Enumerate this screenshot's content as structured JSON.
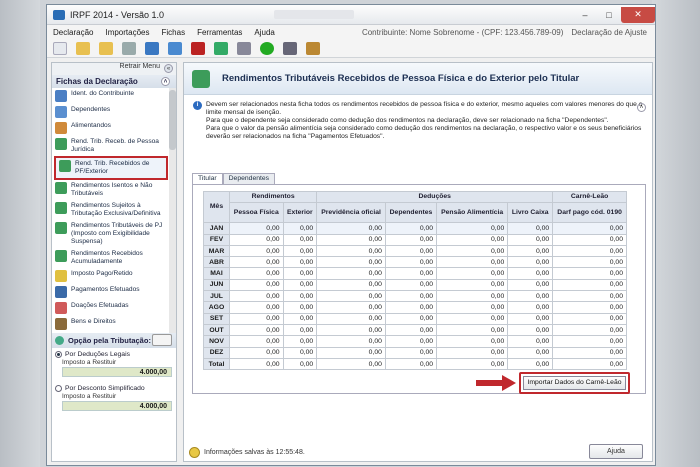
{
  "window": {
    "title": "IRPF 2014 - Versão 1.0"
  },
  "menu": {
    "items": [
      "Declaração",
      "Importações",
      "Fichas",
      "Ferramentas",
      "Ajuda"
    ],
    "contribuinte": "Contribuinte: Nome Sobrenome - (CPF: 123.456.789-09)",
    "tipo": "Declaração de Ajuste"
  },
  "sidebar": {
    "retrair": "Retrair Menu",
    "header": "Fichas da Declaração",
    "items": [
      "Ident. do Contribuinte",
      "Dependentes",
      "Alimentandos",
      "Rend. Trib. Receb. de Pessoa Jurídica",
      "Rend. Trib. Recebidos de PF/Exterior",
      "Rendimentos Isentos e Não Tributáveis",
      "Rendimentos Sujeitos à Tributação Exclusiva/Definitiva",
      "Rendimentos Tributáveis de PJ (Imposto com Exigibilidade Suspensa)",
      "Rendimentos Recebidos Acumuladamente",
      "Imposto Pago/Retido",
      "Pagamentos Efetuados",
      "Doações Efetuadas",
      "Bens e Direitos"
    ],
    "opcao": "Opção pela Tributação:",
    "deducoes": {
      "label": "Por Deduções Legais",
      "sub": "Imposto a Restituir",
      "value": "4.000,00"
    },
    "simplificado": {
      "label": "Por Desconto Simplificado",
      "sub": "Imposto a Restituir",
      "value": "4.000,00"
    }
  },
  "main": {
    "title": "Rendimentos Tributáveis Recebidos de Pessoa Física e do Exterior pelo Titular",
    "info": [
      "Devem ser relacionados nesta ficha todos os rendimentos recebidos de pessoa física e do exterior, mesmo aqueles com valores menores do que o limite mensal de isenção.",
      "Para que o dependente seja considerado como dedução dos rendimentos na declaração, deve ser relacionado na ficha \"Dependentes\".",
      "Para que o valor da pensão alimentícia seja considerado como dedução dos rendimentos na declaração, o respectivo valor e os seus beneficiários deverão ser relacionados na ficha \"Pagamentos Efetuados\"."
    ],
    "tabs": [
      "Titular",
      "Dependentes"
    ],
    "table": {
      "groups": {
        "mes": "Mês",
        "rend": "Rendimentos",
        "ded": "Deduções",
        "carne": "Carnê-Leão"
      },
      "cols": [
        "Pessoa Física",
        "Exterior",
        "Previdência oficial",
        "Dependentes",
        "Pensão Alimentícia",
        "Livro Caixa",
        "Darf pago cód. 0190"
      ],
      "rows": [
        {
          "m": "JAN",
          "v": [
            "0,00",
            "0,00",
            "0,00",
            "0,00",
            "0,00",
            "0,00",
            "0,00"
          ]
        },
        {
          "m": "FEV",
          "v": [
            "0,00",
            "0,00",
            "0,00",
            "0,00",
            "0,00",
            "0,00",
            "0,00"
          ]
        },
        {
          "m": "MAR",
          "v": [
            "0,00",
            "0,00",
            "0,00",
            "0,00",
            "0,00",
            "0,00",
            "0,00"
          ]
        },
        {
          "m": "ABR",
          "v": [
            "0,00",
            "0,00",
            "0,00",
            "0,00",
            "0,00",
            "0,00",
            "0,00"
          ]
        },
        {
          "m": "MAI",
          "v": [
            "0,00",
            "0,00",
            "0,00",
            "0,00",
            "0,00",
            "0,00",
            "0,00"
          ]
        },
        {
          "m": "JUN",
          "v": [
            "0,00",
            "0,00",
            "0,00",
            "0,00",
            "0,00",
            "0,00",
            "0,00"
          ]
        },
        {
          "m": "JUL",
          "v": [
            "0,00",
            "0,00",
            "0,00",
            "0,00",
            "0,00",
            "0,00",
            "0,00"
          ]
        },
        {
          "m": "AGO",
          "v": [
            "0,00",
            "0,00",
            "0,00",
            "0,00",
            "0,00",
            "0,00",
            "0,00"
          ]
        },
        {
          "m": "SET",
          "v": [
            "0,00",
            "0,00",
            "0,00",
            "0,00",
            "0,00",
            "0,00",
            "0,00"
          ]
        },
        {
          "m": "OUT",
          "v": [
            "0,00",
            "0,00",
            "0,00",
            "0,00",
            "0,00",
            "0,00",
            "0,00"
          ]
        },
        {
          "m": "NOV",
          "v": [
            "0,00",
            "0,00",
            "0,00",
            "0,00",
            "0,00",
            "0,00",
            "0,00"
          ]
        },
        {
          "m": "DEZ",
          "v": [
            "0,00",
            "0,00",
            "0,00",
            "0,00",
            "0,00",
            "0,00",
            "0,00"
          ]
        },
        {
          "m": "Total",
          "v": [
            "0,00",
            "0,00",
            "0,00",
            "0,00",
            "0,00",
            "0,00",
            "0,00"
          ]
        }
      ]
    },
    "import_button": "Importar Dados do Carnê-Leão"
  },
  "status": {
    "text": "Informações salvas às 12:55:48.",
    "help": "Ajuda"
  },
  "icons": {
    "app": "irpf-logo-icon",
    "info": "info-icon"
  }
}
